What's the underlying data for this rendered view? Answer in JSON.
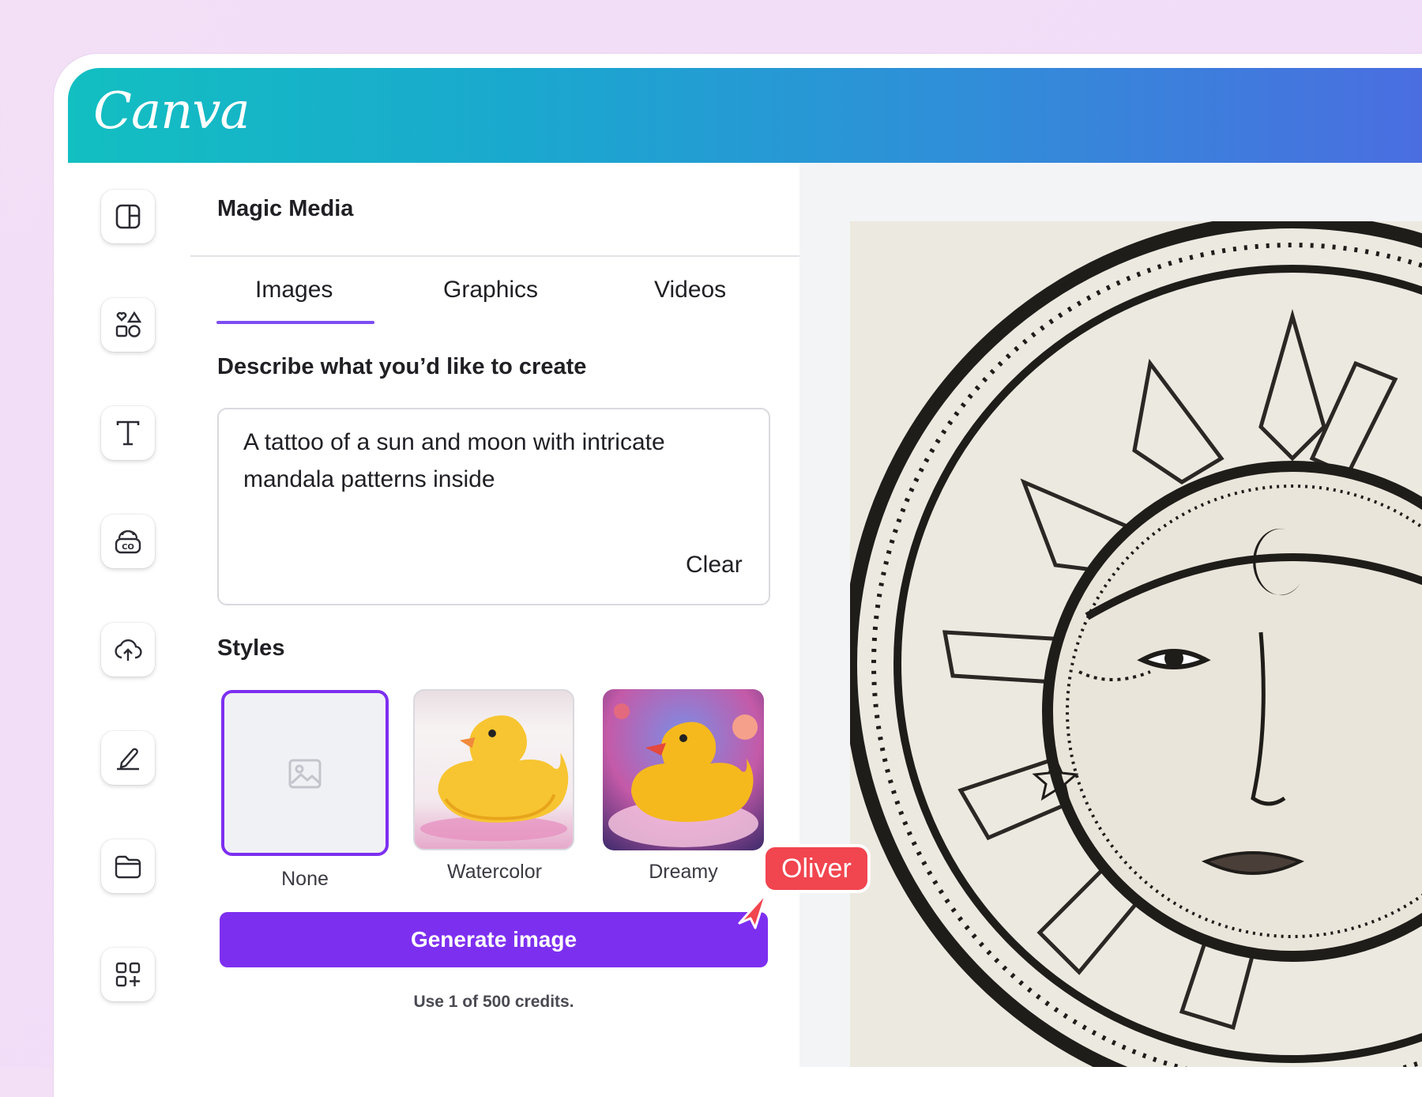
{
  "app": {
    "logo_text": "Canva",
    "brand_gradient": [
      "#12bfc1",
      "#4a6ee0"
    ],
    "accent": "#7d2ff0"
  },
  "sidebar": {
    "items": [
      {
        "name": "design",
        "icon": "layout-icon"
      },
      {
        "name": "elements",
        "icon": "shapes-icon"
      },
      {
        "name": "text",
        "icon": "text-icon"
      },
      {
        "name": "brand",
        "icon": "brand-icon"
      },
      {
        "name": "uploads",
        "icon": "cloud-upload-icon"
      },
      {
        "name": "draw",
        "icon": "pen-icon"
      },
      {
        "name": "projects",
        "icon": "folder-icon"
      },
      {
        "name": "apps",
        "icon": "apps-icon"
      }
    ]
  },
  "panel": {
    "title": "Magic Media",
    "tabs": [
      {
        "label": "Images",
        "active": true
      },
      {
        "label": "Graphics",
        "active": false
      },
      {
        "label": "Videos",
        "active": false
      }
    ],
    "prompt": {
      "label": "Describe what you’d like to create",
      "value": "A tattoo of a sun and moon with intricate mandala patterns inside",
      "clear_label": "Clear"
    },
    "styles": {
      "label": "Styles",
      "options": [
        {
          "label": "None",
          "selected": true,
          "icon": "image-placeholder-icon"
        },
        {
          "label": "Watercolor",
          "selected": false
        },
        {
          "label": "Dreamy",
          "selected": false
        }
      ]
    },
    "generate_label": "Generate image",
    "credits_text": "Use 1 of 500 credits."
  },
  "collaborator": {
    "name": "Oliver",
    "color": "#f1454f"
  }
}
